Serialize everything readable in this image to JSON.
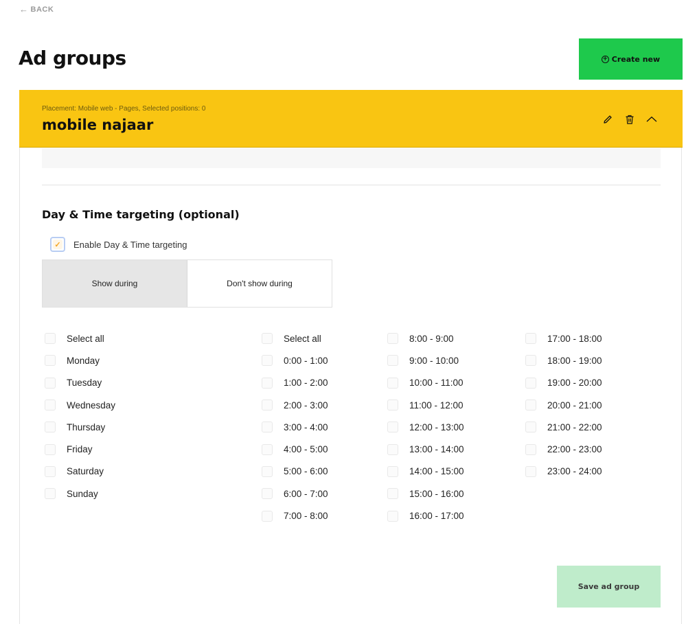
{
  "nav": {
    "back_label": "BACK",
    "back_icon": "arrow-left-icon"
  },
  "page": {
    "title": "Ad groups"
  },
  "create_button": {
    "label": "Create new",
    "icon": "plus-circle-icon",
    "color": "#1ec94c"
  },
  "ad_group": {
    "placement_text": "Placement: Mobile web - Pages, Selected positions: 0",
    "name": "mobile najaar",
    "header_color": "#f9c512",
    "actions": [
      "pencil-icon",
      "trash-icon",
      "chevron-up-icon"
    ]
  },
  "targeting": {
    "section_title": "Day & Time targeting (optional)",
    "enable_label": "Enable Day & Time targeting",
    "enable_checked": true,
    "mode_options": [
      {
        "label": "Show during",
        "active": true
      },
      {
        "label": "Don't show during",
        "active": false
      }
    ],
    "days": [
      "Select all",
      "Monday",
      "Tuesday",
      "Wednesday",
      "Thursday",
      "Friday",
      "Saturday",
      "Sunday"
    ],
    "hours_col1": [
      "Select all",
      "0:00 - 1:00",
      "1:00 - 2:00",
      "2:00 - 3:00",
      "3:00 - 4:00",
      "4:00 - 5:00",
      "5:00 - 6:00",
      "6:00 - 7:00",
      "7:00 - 8:00"
    ],
    "hours_col2": [
      "8:00 - 9:00",
      "9:00 - 10:00",
      "10:00 - 11:00",
      "11:00 - 12:00",
      "12:00 - 13:00",
      "13:00 - 14:00",
      "14:00 - 15:00",
      "15:00 - 16:00",
      "16:00 - 17:00"
    ],
    "hours_col3": [
      "17:00 - 18:00",
      "18:00 - 19:00",
      "19:00 - 20:00",
      "20:00 - 21:00",
      "21:00 - 22:00",
      "22:00 - 23:00",
      "23:00 - 24:00"
    ]
  },
  "save_button": {
    "label": "Save ad group",
    "color": "#bfeccb"
  }
}
